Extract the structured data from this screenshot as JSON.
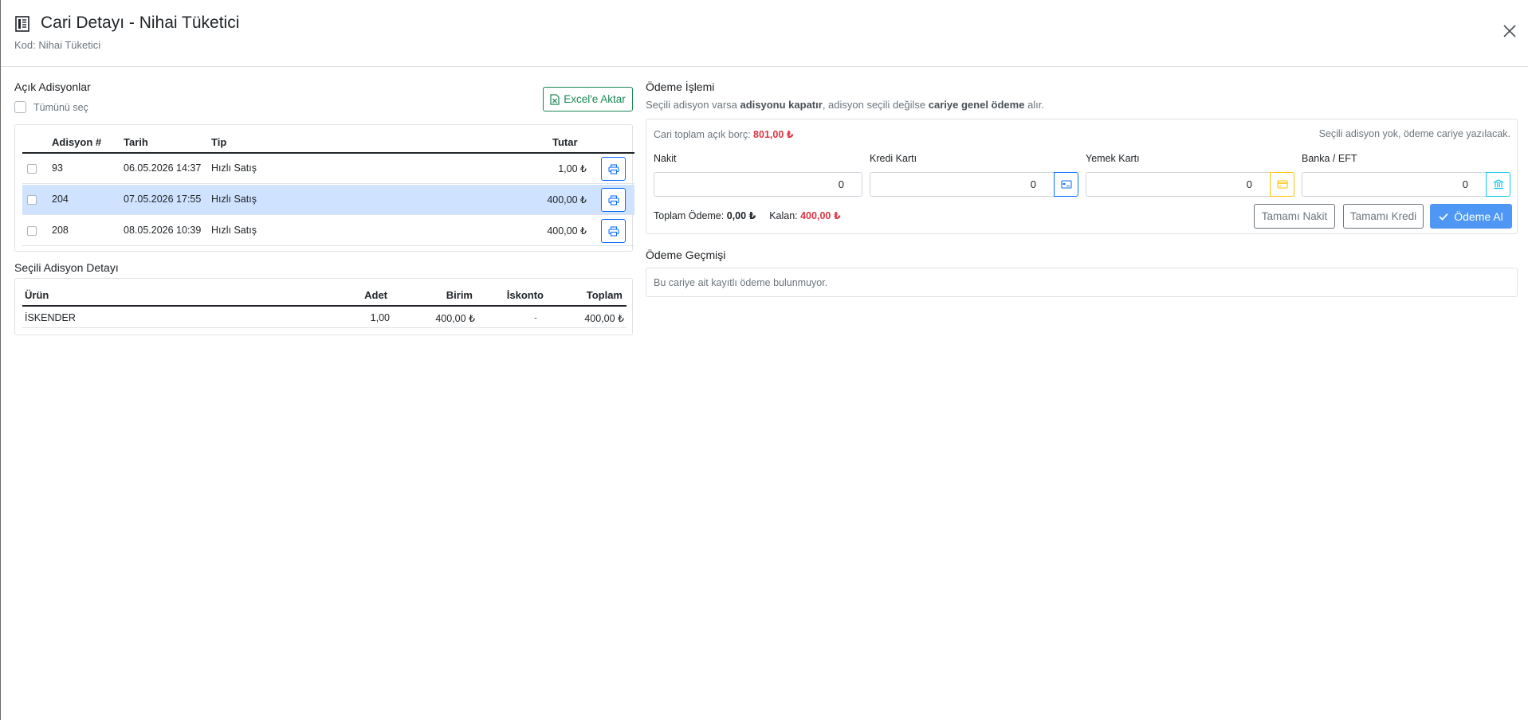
{
  "header": {
    "title": "Cari Detayı - Nihai Tüketici",
    "subtitle": "Kod: Nihai Tüketici"
  },
  "open_checks": {
    "title": "Açık Adisyonlar",
    "select_all": "Tümünü seç",
    "export_label": "Excel'e Aktar",
    "columns": [
      "Adisyon #",
      "Tarih",
      "Tip",
      "Tutar"
    ],
    "rows": [
      {
        "no": "93",
        "date": "06.05.2026 14:37",
        "type": "Hızlı Satış",
        "amount": "1,00 ₺",
        "selected": false
      },
      {
        "no": "204",
        "date": "07.05.2026 17:55",
        "type": "Hızlı Satış",
        "amount": "400,00 ₺",
        "selected": true
      },
      {
        "no": "208",
        "date": "08.05.2026 10:39",
        "type": "Hızlı Satış",
        "amount": "400,00 ₺",
        "selected": false
      }
    ]
  },
  "detail": {
    "title": "Seçili Adisyon Detayı",
    "columns": [
      "Ürün",
      "Adet",
      "Birim",
      "İskonto",
      "Toplam"
    ],
    "rows": [
      {
        "product": "İSKENDER",
        "qty": "1,00",
        "unit": "400,00 ₺",
        "discount": "-",
        "total": "400,00 ₺"
      }
    ]
  },
  "payment": {
    "title": "Ödeme İşlemi",
    "desc_1": "Seçili adisyon varsa ",
    "desc_b1": "adisyonu kapatır",
    "desc_2": ", adisyon seçili değilse ",
    "desc_b2": "cariye genel ödeme",
    "desc_3": " alır.",
    "debt_label": "Cari toplam açık borç: ",
    "debt_value": "801,00 ₺",
    "note": "Seçili adisyon yok, ödeme cariye yazılacak.",
    "fields": [
      {
        "label": "Nakit",
        "value": "0"
      },
      {
        "label": "Kredi Kartı",
        "value": "0"
      },
      {
        "label": "Yemek Kartı",
        "value": "0"
      },
      {
        "label": "Banka / EFT",
        "value": "0"
      }
    ],
    "total_label": "Toplam Ödeme: ",
    "total_value": "0,00 ₺",
    "remaining_label": "Kalan: ",
    "remaining_value": "400,00 ₺",
    "btn_all_cash": "Tamamı Nakit",
    "btn_all_credit": "Tamamı Kredi",
    "btn_pay": "Ödeme Al",
    "colors": {
      "credit": "#0d6efd",
      "meal": "#ffc107",
      "bank": "#0dcaf0",
      "danger": "#dc3545"
    }
  },
  "history": {
    "title": "Ödeme Geçmişi",
    "empty": "Bu cariye ait kayıtlı ödeme bulunmuyor."
  }
}
